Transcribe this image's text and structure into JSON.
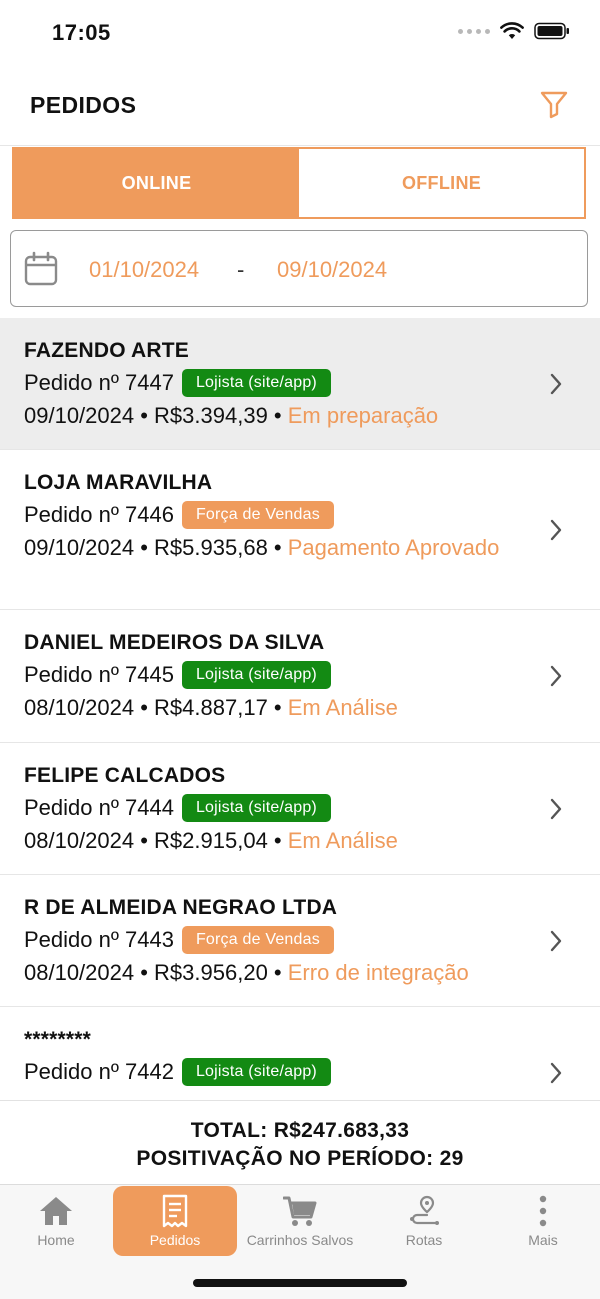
{
  "status_bar": {
    "time": "17:05"
  },
  "header": {
    "title": "PEDIDOS"
  },
  "tabs": [
    {
      "label": "ONLINE",
      "active": true
    },
    {
      "label": "OFFLINE",
      "active": false
    }
  ],
  "date_range": {
    "start": "01/10/2024",
    "separator": "-",
    "end": "09/10/2024"
  },
  "orders": [
    {
      "client": "FAZENDO ARTE",
      "pedido": "Pedido nº 7447",
      "badge": "Lojista (site/app)",
      "badge_color": "#138a13",
      "date": "09/10/2024",
      "value": "R$3.394,39",
      "status": "Em preparação",
      "selected": true
    },
    {
      "client": "LOJA MARAVILHA",
      "pedido": "Pedido nº 7446",
      "badge": "Força de Vendas",
      "badge_color": "#ef9b5c",
      "date": "09/10/2024",
      "value": "R$5.935,68",
      "status": "Pagamento Aprovado",
      "selected": false
    },
    {
      "client": "DANIEL MEDEIROS DA SILVA",
      "pedido": "Pedido nº 7445",
      "badge": "Lojista (site/app)",
      "badge_color": "#138a13",
      "date": "08/10/2024",
      "value": "R$4.887,17",
      "status": "Em Análise",
      "selected": false
    },
    {
      "client": "FELIPE CALCADOS",
      "pedido": "Pedido nº 7444",
      "badge": "Lojista (site/app)",
      "badge_color": "#138a13",
      "date": "08/10/2024",
      "value": "R$2.915,04",
      "status": "Em Análise",
      "selected": false
    },
    {
      "client": "R DE ALMEIDA NEGRAO LTDA",
      "pedido": "Pedido nº 7443",
      "badge": "Força de Vendas",
      "badge_color": "#ef9b5c",
      "date": "08/10/2024",
      "value": "R$3.956,20",
      "status": "Erro de integração",
      "selected": false
    },
    {
      "client": "********",
      "pedido": "Pedido nº 7442",
      "badge": "Lojista (site/app)",
      "badge_color": "#138a13",
      "date": "",
      "value": "",
      "status": "",
      "selected": false
    }
  ],
  "totals": {
    "total": "TOTAL: R$247.683,33",
    "positivacao": "POSITIVAÇÃO NO PERÍODO: 29"
  },
  "bottom_nav": [
    {
      "label": "Home",
      "icon": "home-icon",
      "active": false
    },
    {
      "label": "Pedidos",
      "icon": "receipt-icon",
      "active": true
    },
    {
      "label": "Carrinhos Salvos",
      "icon": "cart-icon",
      "active": false
    },
    {
      "label": "Rotas",
      "icon": "route-icon",
      "active": false
    },
    {
      "label": "Mais",
      "icon": "more-vertical-icon",
      "active": false
    }
  ],
  "colors": {
    "accent": "#ef9b5c",
    "green_badge": "#138a13"
  }
}
